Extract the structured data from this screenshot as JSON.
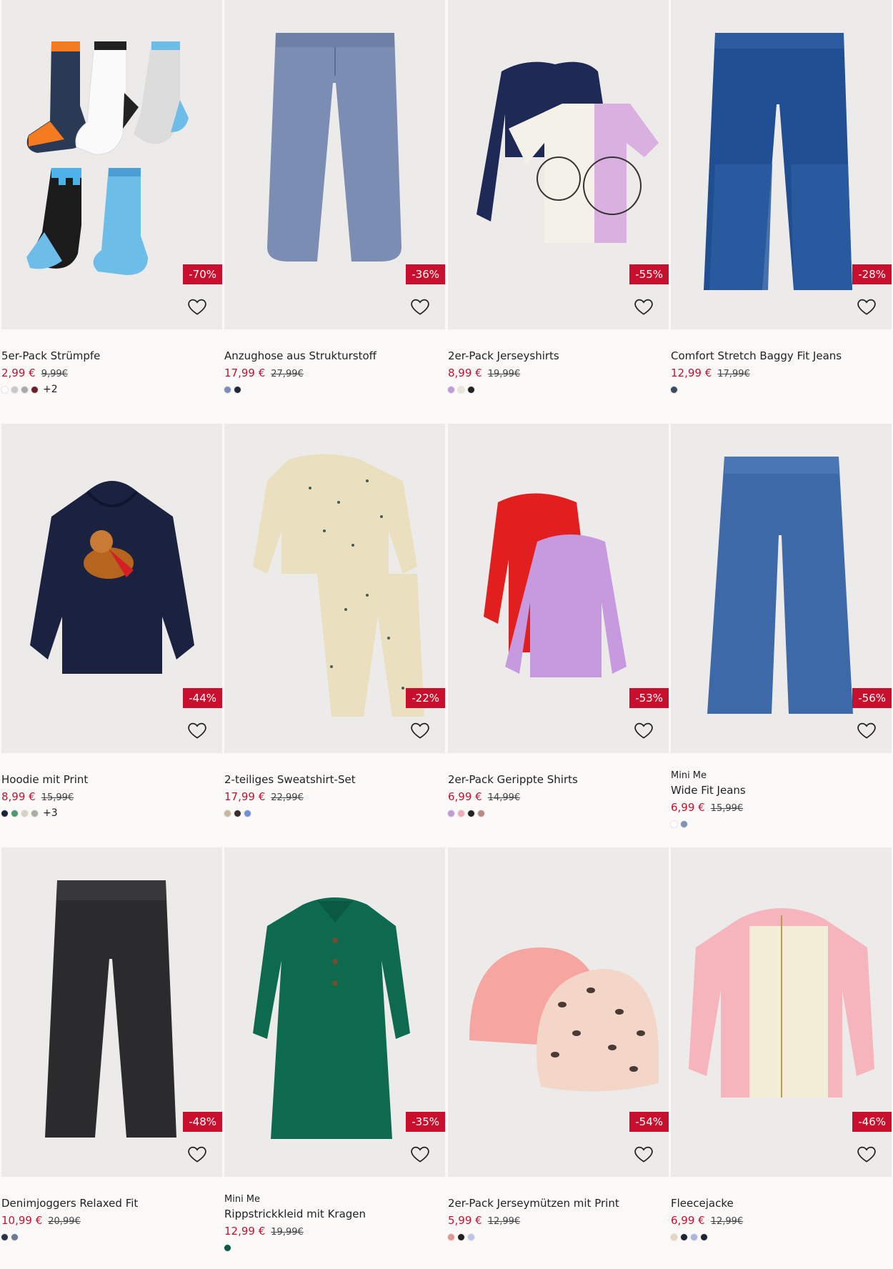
{
  "products": [
    {
      "name": "5er-Pack Strümpfe",
      "price": "2,99 €",
      "old_price": "9,99€",
      "discount": "-70%",
      "swatches": [
        "#ffffff",
        "#c8c8c8",
        "#a9a9a9",
        "#6e1e2a"
      ],
      "more": "+2",
      "art": "socks"
    },
    {
      "name": "Anzughose aus Strukturstoff",
      "price": "17,99 €",
      "old_price": "27,99€",
      "discount": "-36%",
      "swatches": [
        "#7a8fb5",
        "#1e2a3a"
      ],
      "art": "trousers"
    },
    {
      "name": "2er-Pack Jerseyshirts",
      "price": "8,99 €",
      "old_price": "19,99€",
      "discount": "-55%",
      "swatches": [
        "#c29ad6",
        "#e8e4d6",
        "#222222"
      ],
      "art": "shirts"
    },
    {
      "name": "Comfort Stretch Baggy Fit Jeans",
      "price": "12,99 €",
      "old_price": "17,99€",
      "discount": "-28%",
      "swatches": [
        "#3a4a66"
      ],
      "art": "jeans"
    },
    {
      "name": "Hoodie mit Print",
      "price": "8,99 €",
      "old_price": "15,99€",
      "discount": "-44%",
      "swatches": [
        "#1c2233",
        "#4d9a72",
        "#d8d2c2",
        "#a4b0a3"
      ],
      "more": "+3",
      "art": "hoodie"
    },
    {
      "name": "2-teiliges Sweatshirt-Set",
      "price": "17,99 €",
      "old_price": "22,99€",
      "discount": "-22%",
      "swatches": [
        "#c9b89c",
        "#3a2a2e",
        "#6f90d8"
      ],
      "art": "sweatset"
    },
    {
      "name": "2er-Pack Gerippte Shirts",
      "price": "6,99 €",
      "old_price": "14,99€",
      "discount": "-53%",
      "swatches": [
        "#c29ad6",
        "#f3a9b7",
        "#222222",
        "#b88a86"
      ],
      "art": "ribshirts"
    },
    {
      "brand": "Mini Me",
      "name": "Wide Fit Jeans",
      "price": "6,99 €",
      "old_price": "15,99€",
      "discount": "-56%",
      "swatches": [
        "#ffffff",
        "#7d93b5"
      ],
      "art": "widejeans"
    },
    {
      "name": "Denimjoggers Relaxed Fit",
      "price": "10,99 €",
      "old_price": "20,99€",
      "discount": "-48%",
      "swatches": [
        "#2a3344",
        "#6e7a92"
      ],
      "art": "joggers"
    },
    {
      "brand": "Mini Me",
      "name": "Rippstrickkleid mit Kragen",
      "price": "12,99 €",
      "old_price": "19,99€",
      "discount": "-35%",
      "swatches": [
        "#0c5a45"
      ],
      "art": "dress"
    },
    {
      "name": "2er-Pack Jerseymützen mit Print",
      "price": "5,99 €",
      "old_price": "12,99€",
      "discount": "-54%",
      "swatches": [
        "#e6948f",
        "#222222",
        "#b9c6e8"
      ],
      "art": "hats"
    },
    {
      "name": "Fleecejacke",
      "price": "6,99 €",
      "old_price": "12,99€",
      "discount": "-46%",
      "swatches": [
        "#e3d6bd",
        "#1e2233",
        "#a7b5e0",
        "#1e2233"
      ],
      "art": "fleece"
    }
  ],
  "colors": {
    "accent": "#c8102e",
    "card_bg": "#ecebe9",
    "page_bg": "#faf9f8"
  },
  "icons": {
    "favorite": "heart-outline-icon"
  }
}
